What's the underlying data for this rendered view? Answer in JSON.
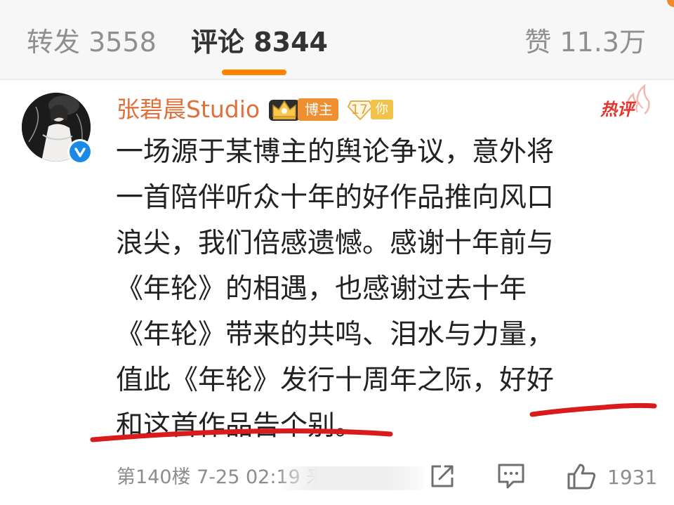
{
  "tabs": {
    "repost": "转发 3558",
    "comments": "评论 8344",
    "likes": "赞 11.3万"
  },
  "comment": {
    "username": "张碧晨Studio",
    "badge_blogger": "博主",
    "fan_level": "17",
    "fan_level_suffix": "你",
    "hot_tag": "热评",
    "lines": [
      "一场源于某博主的舆论争议，意外将",
      "一首陪伴听众十年的好作品推向风口",
      "浪尖，我们倍感遗憾。感谢十年前与",
      "《年轮》的相遇，也感谢过去十年",
      "《年轮》带来的共鸣、泪水与力量，",
      "值此《年轮》发行十周年之际，好好",
      "和这首作品告个别。"
    ],
    "floor_info": "第140楼 7-25 02:19 来",
    "like_count": "1931"
  },
  "colors": {
    "accent_orange": "#ff8200",
    "username": "#e16f3a",
    "hot_red": "#e3342f",
    "verified_blue": "#1a8ae6",
    "annotation_red": "#d81c1c"
  },
  "icons": [
    "crown-icon",
    "fan-level-icon",
    "flame-icon",
    "verified-icon",
    "share-icon",
    "comment-icon",
    "like-icon"
  ]
}
